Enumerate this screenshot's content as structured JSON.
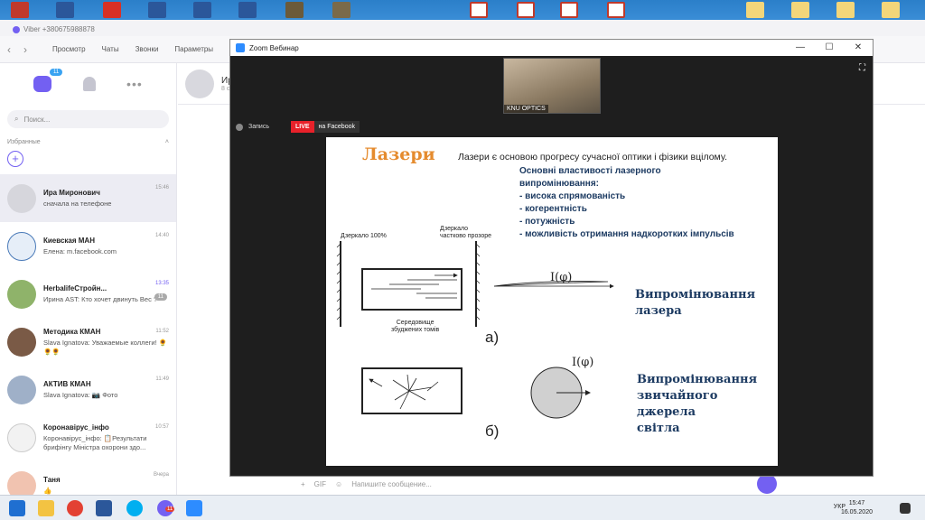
{
  "viber": {
    "window_title": "Viber +380675988878",
    "menu": [
      "Просмотр",
      "Чаты",
      "Звонки",
      "Параметры"
    ],
    "tab_badge": "11",
    "search_placeholder": "Поиск...",
    "favorites_label": "Избранные",
    "chats": [
      {
        "name": "Ира Миронович",
        "msg": "сначала на телефоне",
        "time": "15:46"
      },
      {
        "name": "Киевская МАН",
        "msg": "Елена: m.facebook.com",
        "time": "14:40"
      },
      {
        "name": "HerbalifeСтройн...",
        "msg": "Ирина AST: Кто хочет двинуть Вес ?",
        "time": "13:35",
        "badge": "11"
      },
      {
        "name": "Методика КМАН",
        "msg": "Slava Ignatova: Уважаемые коллеги! 🌻🌻🌻",
        "time": "11:52"
      },
      {
        "name": "АКТИВ КМАН",
        "msg": "Slava Ignatova: 📷 Фото",
        "time": "11:49"
      },
      {
        "name": "Коронавірус_інфо",
        "msg": "Коронавірус_інфо: 📋Результати брифінгу Міністра охорони здо...",
        "time": "10:57"
      },
      {
        "name": "Таня",
        "msg": "👍",
        "time": "Вчера"
      }
    ],
    "conv_name": "Ир",
    "conv_sub": "8 с",
    "input_placeholder": "Напишите сообщение..."
  },
  "zoom": {
    "title": "Zoom Вебинар",
    "cam_label": "KNU OPTICS",
    "record_label": "Запись",
    "live": "LIVE",
    "facebook": "на Facebook"
  },
  "slide": {
    "title": "Лазери",
    "intro": "Лазери є основою прогресу сучасної оптики і фізики вцілому.",
    "props_header": [
      "Основні властивості лазерного",
      "випромінювання:"
    ],
    "props": [
      "- висока спрямованість",
      "- когерентність",
      "- потужність",
      "- можливість отримання надкоротких імпульсів"
    ],
    "mirror_full": "Дзеркало 100%",
    "mirror_partial": [
      "Дзеркало",
      "частково прозоре"
    ],
    "medium": [
      "Середовище",
      "збуджених томів"
    ],
    "label_a": "а)",
    "label_b": "б)",
    "intensity": "I(φ)",
    "laser_caption": [
      "Випромінювання",
      "лазера"
    ],
    "ordinary_caption": [
      "Випромінювання",
      "звичайного джерела",
      "світла"
    ]
  },
  "taskbar": {
    "lang": "УКР",
    "time": "15:47",
    "date": "16.05.2020",
    "viber_badge": "11"
  }
}
